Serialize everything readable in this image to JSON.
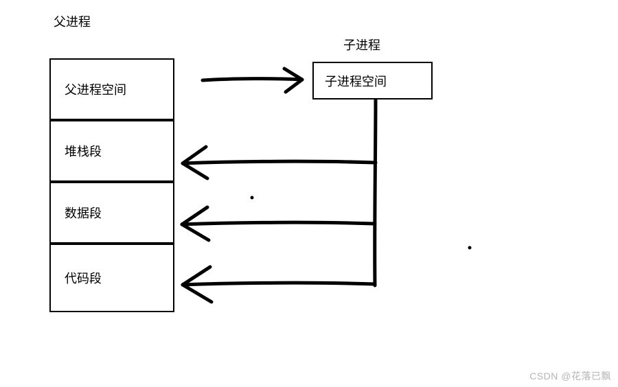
{
  "title_parent": "父进程",
  "title_child": "子进程",
  "parent_sections": {
    "space": "父进程空间",
    "stack": "堆栈段",
    "data": "数据段",
    "code": "代码段"
  },
  "child_sections": {
    "space": "子进程空间"
  },
  "watermark": "CSDN @花落已飘"
}
